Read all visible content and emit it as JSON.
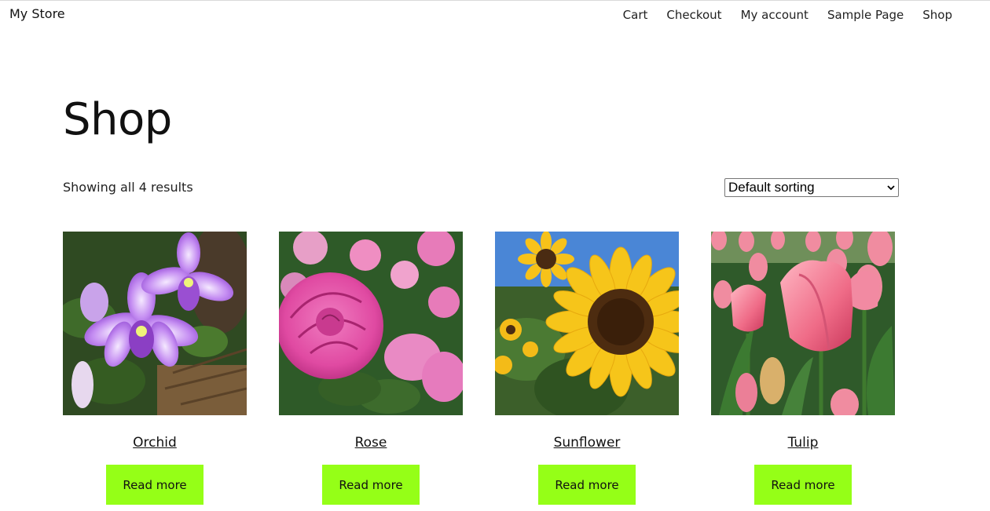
{
  "header": {
    "site_title": "My Store",
    "nav": [
      "Cart",
      "Checkout",
      "My account",
      "Sample Page",
      "Shop"
    ]
  },
  "main": {
    "title": "Shop",
    "result_count": "Showing all 4 results",
    "sorting": {
      "selected": "Default sorting"
    }
  },
  "products": [
    {
      "name": "Orchid",
      "button": "Read more",
      "image": "orchid"
    },
    {
      "name": "Rose",
      "button": "Read more",
      "image": "rose"
    },
    {
      "name": "Sunflower",
      "button": "Read more",
      "image": "sunflower"
    },
    {
      "name": "Tulip",
      "button": "Read more",
      "image": "tulip"
    }
  ],
  "colors": {
    "button_bg": "#95ff17",
    "text": "#111111"
  }
}
